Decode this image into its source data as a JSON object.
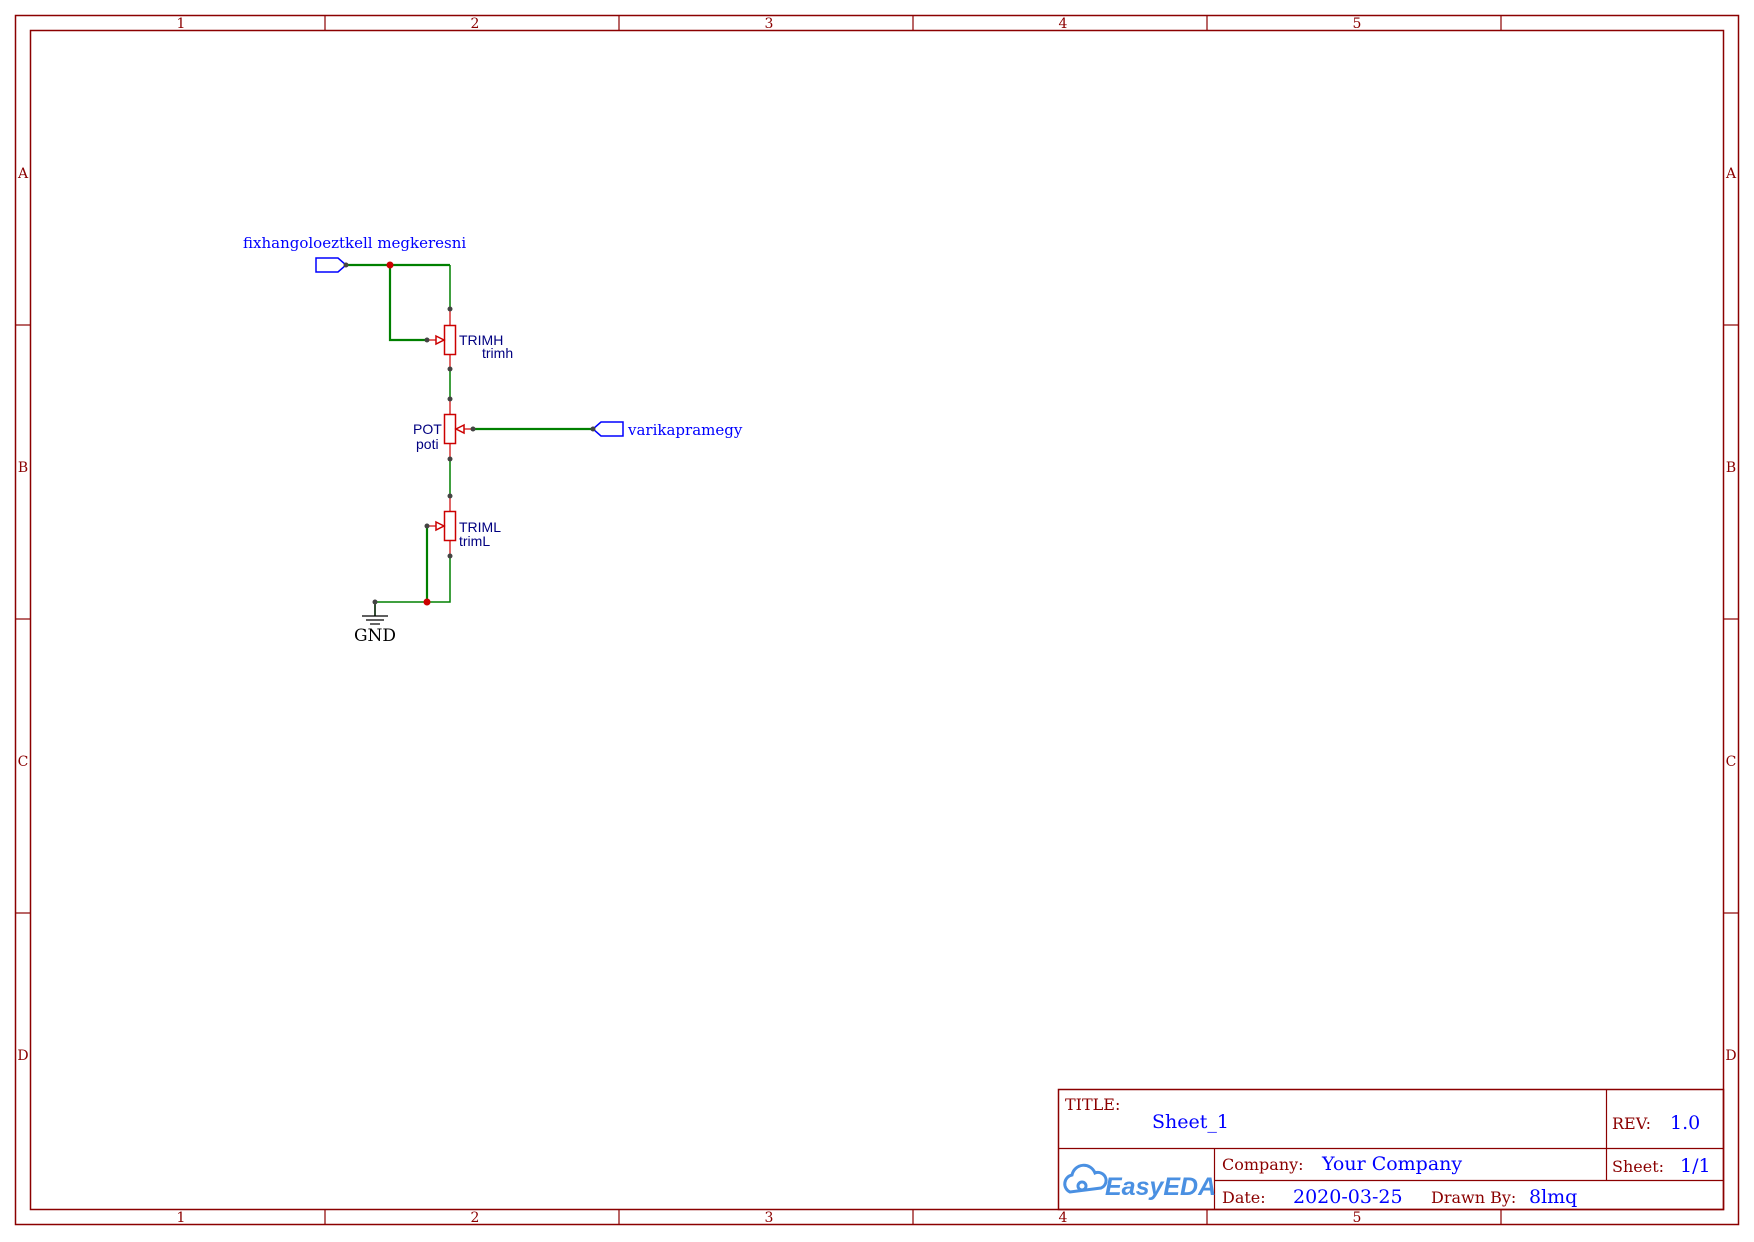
{
  "frame": {
    "columns": [
      "1",
      "2",
      "3",
      "4",
      "5"
    ],
    "rows": [
      "A",
      "B",
      "C",
      "D"
    ]
  },
  "net_labels": {
    "input": "fixhangoloeztkell megkeresni",
    "output": "varikapramegy",
    "ground": "GND"
  },
  "components": {
    "trimh": {
      "ref": "TRIMH",
      "value": "trimh"
    },
    "pot": {
      "ref": "POT",
      "value": "poti"
    },
    "triml": {
      "ref": "TRIML",
      "value": "trimL"
    }
  },
  "title_block": {
    "title_label": "TITLE:",
    "title": "Sheet_1",
    "rev_label": "REV:",
    "rev": "1.0",
    "company_label": "Company:",
    "company": "Your Company",
    "sheet_label": "Sheet:",
    "sheet": "1/1",
    "date_label": "Date:",
    "date": "2020-03-25",
    "drawn_by_label": "Drawn By:",
    "drawn_by": "8lmq",
    "logo_text": "EasyEDA"
  },
  "colors": {
    "frame": "#8b0000",
    "wire": "#008000",
    "text_blue": "#0000ff",
    "component_text": "#000080",
    "junction": "#cc0000",
    "logo": "#4a90e2"
  },
  "icons": {
    "logo": "easyeda-cloud-icon",
    "ground": "ground-symbol-icon"
  }
}
